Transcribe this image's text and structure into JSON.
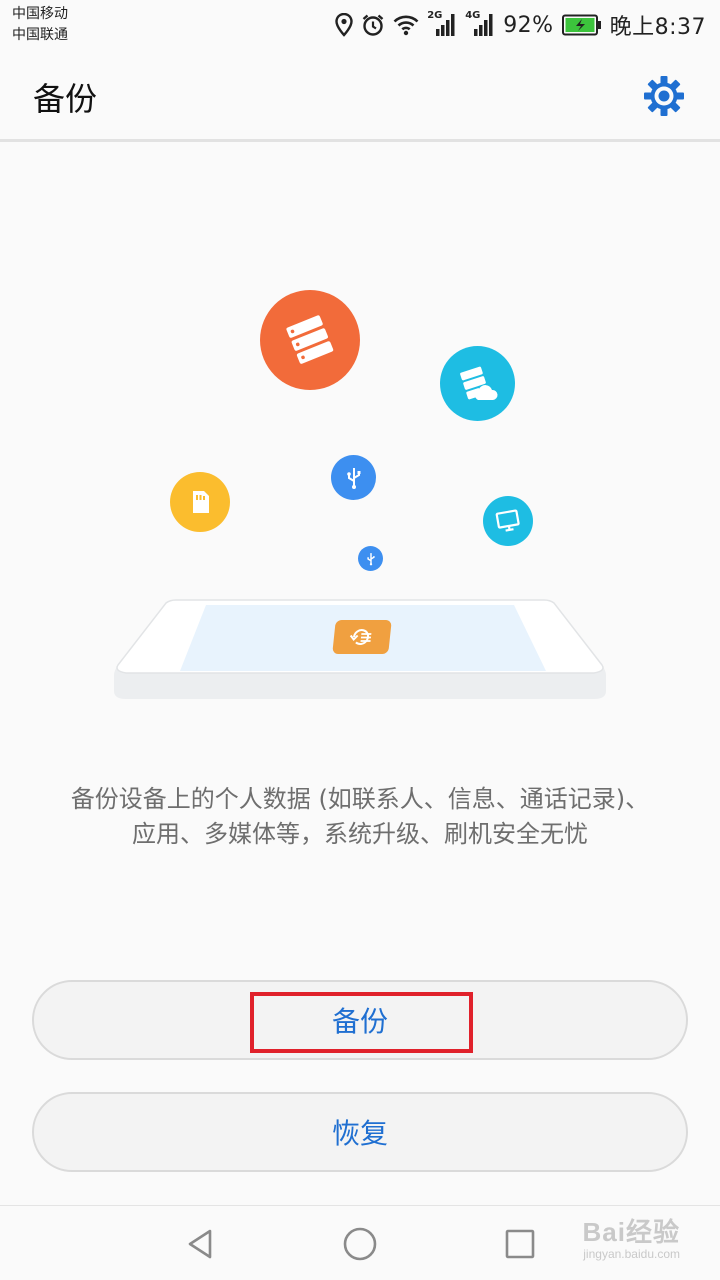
{
  "status_bar": {
    "carrier_1": "中国移动",
    "carrier_2": "中国联通",
    "network_1": "2G",
    "network_2": "4G",
    "battery_percent": "92%",
    "time": "晚上8:37",
    "icons": [
      "location-icon",
      "alarm-icon",
      "wifi-icon",
      "signal-icon",
      "battery-charging-icon"
    ]
  },
  "app_bar": {
    "title": "备份",
    "settings_icon": "gear-icon"
  },
  "illustration": {
    "icons": [
      "server-icon",
      "cloud-server-icon",
      "usb-icon",
      "sd-card-icon",
      "computer-icon",
      "backup-restore-icon"
    ],
    "colors": {
      "orange": "#f26b3a",
      "cyan": "#1ebde3",
      "blue": "#3d8ff0",
      "yellow": "#fbbd2e",
      "app_orange": "#f0a040"
    }
  },
  "description": {
    "line_1": "备份设备上的个人数据 (如联系人、信息、通话记录)、",
    "line_2": "应用、多媒体等，系统升级、刷机安全无忧"
  },
  "buttons": {
    "backup": "备份",
    "restore": "恢复"
  },
  "nav_bar": {
    "icons": [
      "back-icon",
      "home-icon",
      "recents-icon"
    ]
  },
  "watermark": {
    "brand": "Bai经验",
    "url": "jingyan.baidu.com"
  },
  "colors": {
    "accent": "#1f6fd1",
    "highlight": "#e0212b",
    "battery": "#3cc43c"
  }
}
